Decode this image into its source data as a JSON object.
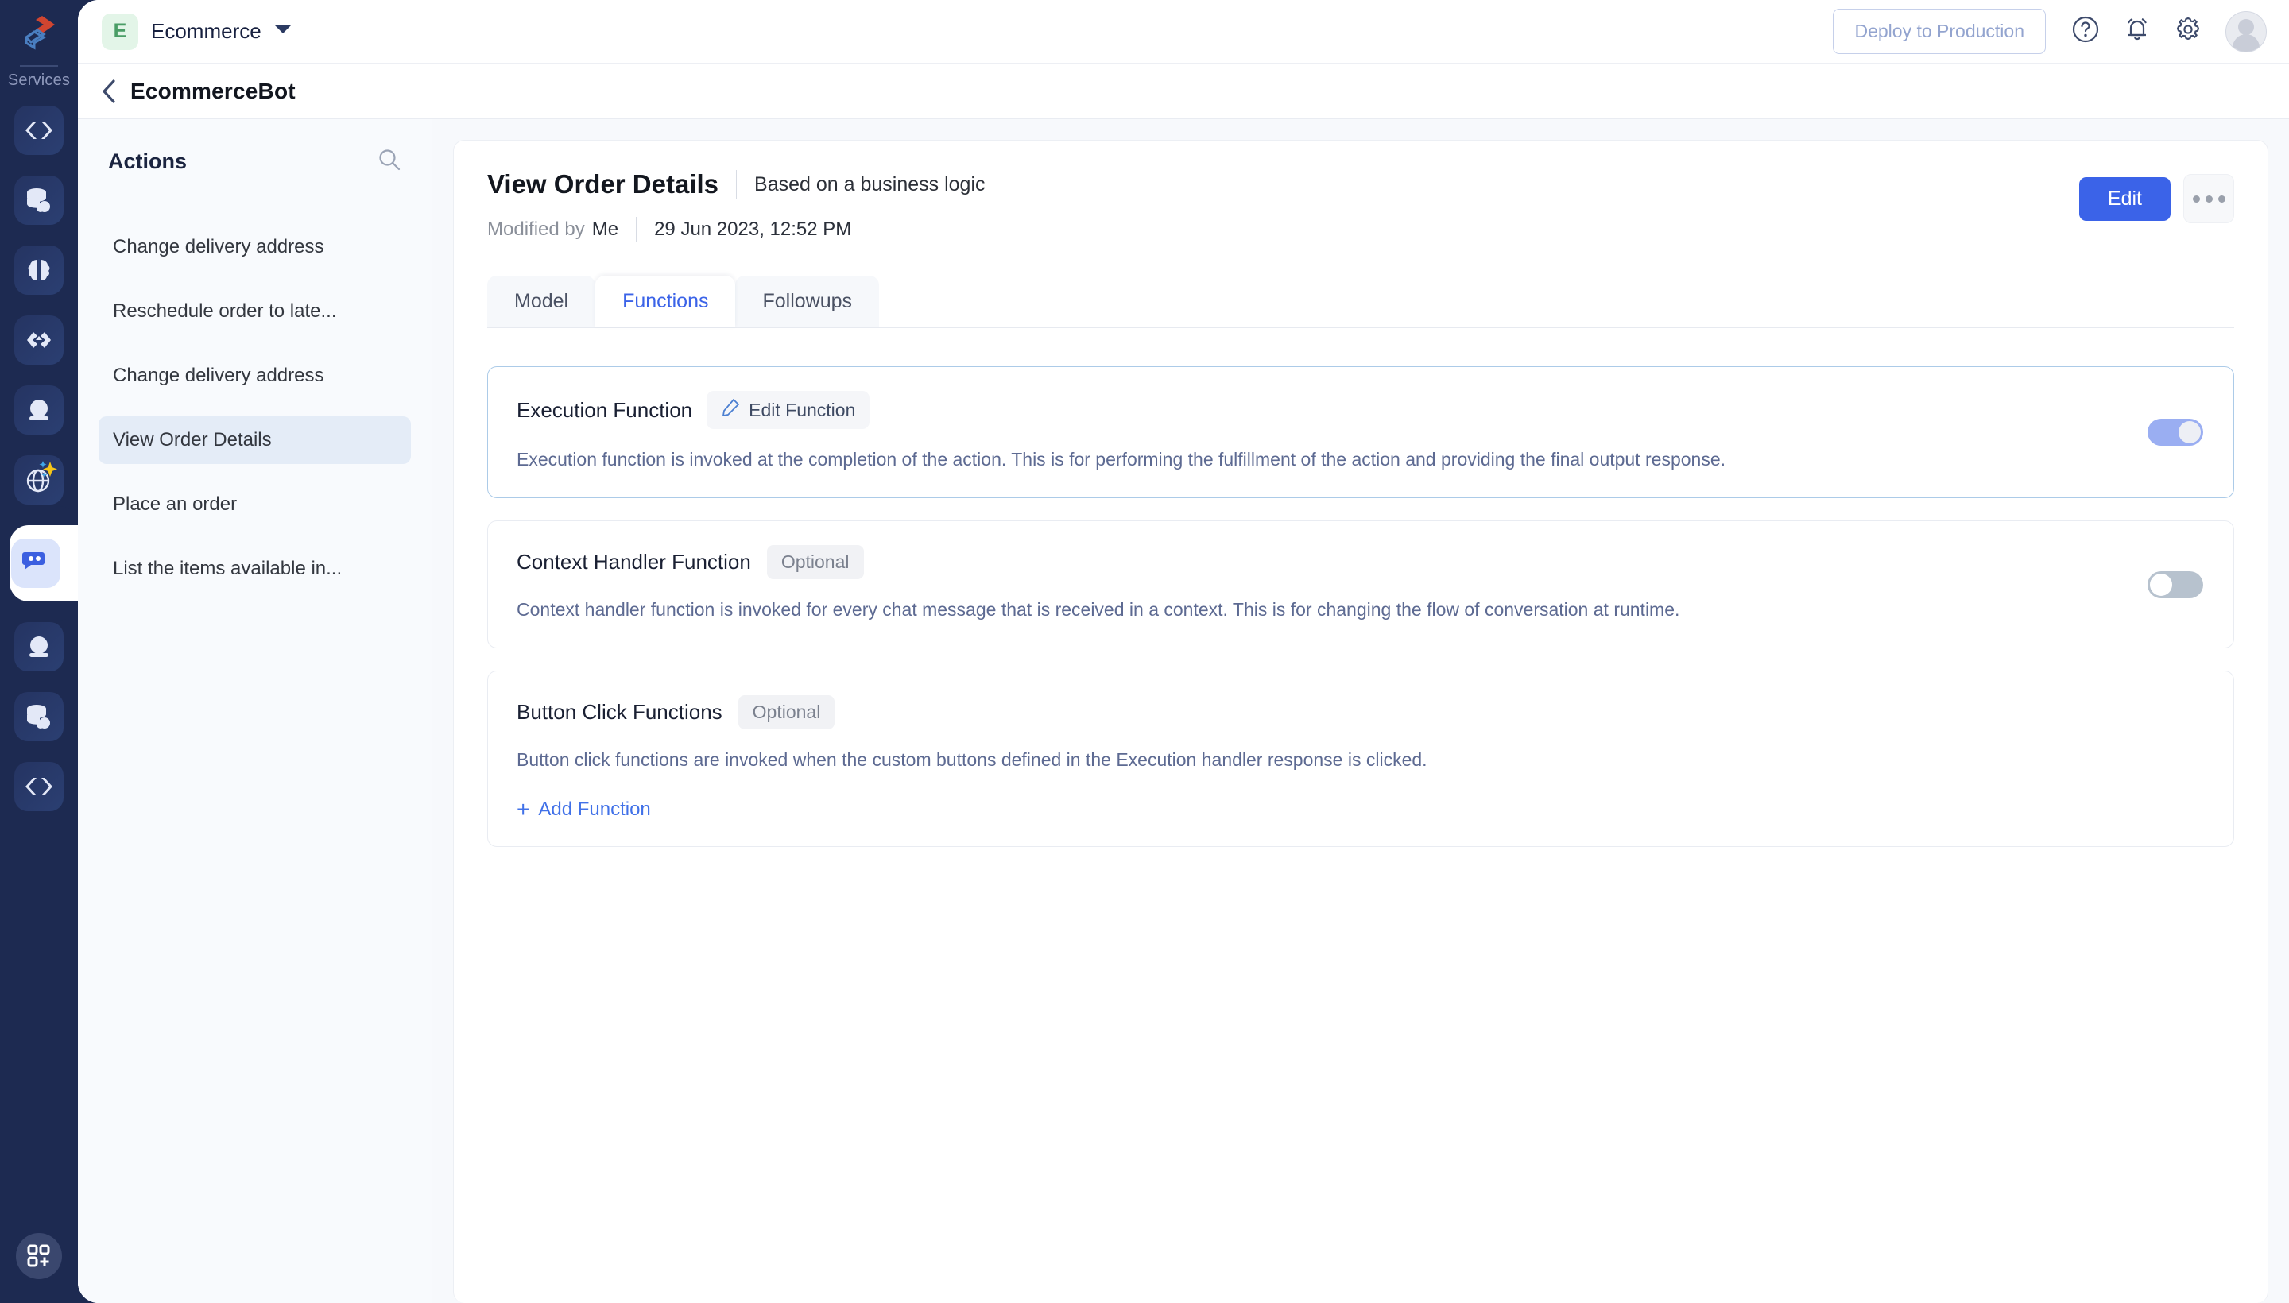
{
  "rail": {
    "logo_icon": "brand-logo-icon",
    "services_label": "Services",
    "items": [
      {
        "icon": "code-brackets-icon",
        "name": "service-code"
      },
      {
        "icon": "database-cloud-icon",
        "name": "service-database"
      },
      {
        "icon": "brain-icon",
        "name": "service-ai"
      },
      {
        "icon": "link-nodes-icon",
        "name": "service-integrations"
      },
      {
        "icon": "chat-bubble-icon",
        "name": "service-chat"
      },
      {
        "icon": "globe-sparkle-icon",
        "name": "service-globe-ai"
      },
      {
        "icon": "chat-dots-icon",
        "name": "service-bots",
        "active": true
      },
      {
        "icon": "chat-bubble-icon",
        "name": "service-conversations"
      },
      {
        "icon": "database-cloud-icon",
        "name": "service-data"
      },
      {
        "icon": "code-brackets-icon",
        "name": "service-developer"
      }
    ],
    "bottom_icon": "grid-plus-icon"
  },
  "topbar": {
    "workspace_initial": "E",
    "workspace_name": "Ecommerce",
    "workspace_caret": "chevron-down-icon",
    "deploy_label": "Deploy to Production",
    "help_icon": "help-circle-icon",
    "notification_icon": "bell-icon",
    "settings_icon": "gear-icon",
    "avatar_icon": "user-avatar"
  },
  "breadcrumb": {
    "back_icon": "chevron-left-icon",
    "title": "EcommerceBot"
  },
  "actions_panel": {
    "title": "Actions",
    "search_icon": "search-icon",
    "items": [
      {
        "label": "Change delivery address",
        "selected": false
      },
      {
        "label": "Reschedule order to late...",
        "selected": false
      },
      {
        "label": "Change delivery address",
        "selected": false
      },
      {
        "label": "View Order Details",
        "selected": true
      },
      {
        "label": "Place an order",
        "selected": false
      },
      {
        "label": "List the items available in...",
        "selected": false
      }
    ]
  },
  "detail": {
    "title": "View Order Details",
    "subtitle": "Based on a business logic",
    "modified_label": "Modified by",
    "modified_by": "Me",
    "modified_date": "29 Jun 2023, 12:52 PM",
    "edit_label": "Edit",
    "more_icon": "ellipsis-icon",
    "tabs": [
      {
        "label": "Model",
        "active": false
      },
      {
        "label": "Functions",
        "active": true
      },
      {
        "label": "Followups",
        "active": false
      }
    ],
    "cards": [
      {
        "title": "Execution Function",
        "chip": "Edit Function",
        "chip_icon": "pencil-icon",
        "chip_type": "edit",
        "description": "Execution function is invoked at the completion of the action. This is for performing the fulfillment of the action and providing the final output response.",
        "toggle": "on",
        "highlight": true
      },
      {
        "title": "Context Handler Function",
        "chip": "Optional",
        "chip_type": "badge",
        "description": "Context handler function is invoked for every chat message that is received in a context. This is for changing the flow of conversation at runtime.",
        "toggle": "off",
        "highlight": false
      },
      {
        "title": "Button Click Functions",
        "chip": "Optional",
        "chip_type": "badge",
        "description": "Button click functions are invoked when the custom buttons defined in the Execution handler response is clicked.",
        "add_label": "Add Function",
        "add_icon": "plus-icon",
        "toggle": null,
        "highlight": false
      }
    ]
  },
  "colors": {
    "accent": "#3b63e8",
    "rail_bg": "#1d2a51",
    "badge_green": "#4a9d66",
    "toggle_on": "#9aaef2",
    "toggle_off": "#b7c2ce",
    "link": "#4171e8"
  }
}
